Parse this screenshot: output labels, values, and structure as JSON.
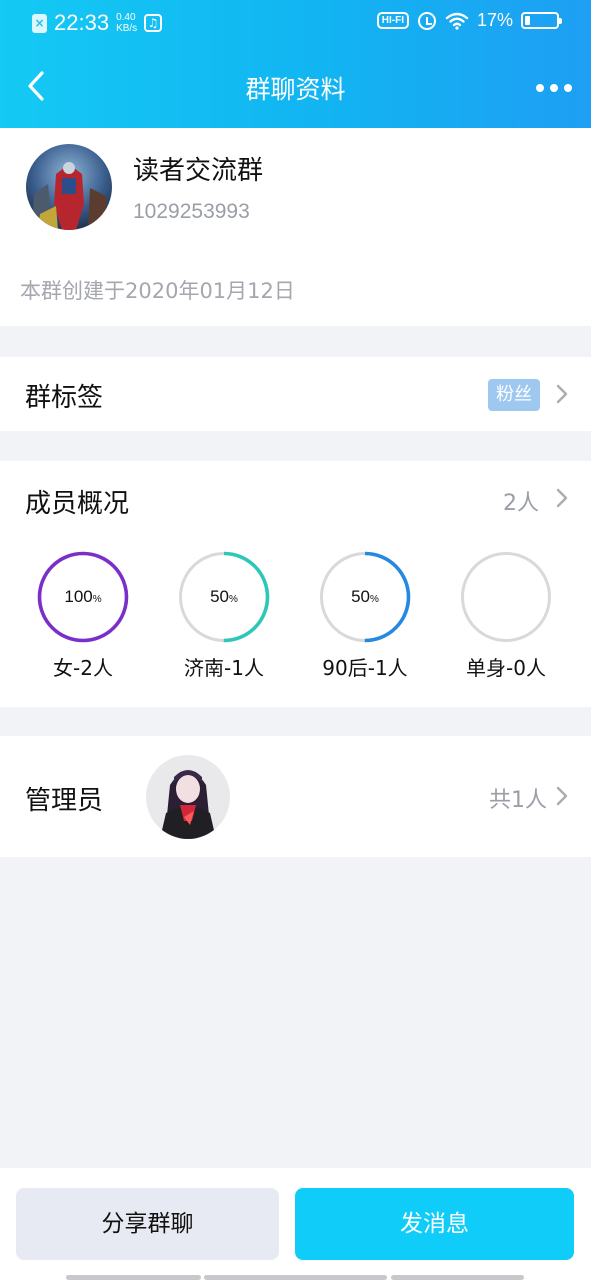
{
  "status_bar": {
    "time": "22:33",
    "speed_value": "0.40",
    "speed_unit": "KB/s",
    "hifi": "HI-FI",
    "battery": "17%",
    "battery_level": 0.17
  },
  "header": {
    "title": "群聊资料",
    "back_icon": "chevron-left-icon",
    "more_icon": "more-dots-icon"
  },
  "group": {
    "name": "读者交流群",
    "id": "1029253993",
    "created": "本群创建于2020年01月12日"
  },
  "tags": {
    "label": "群标签",
    "tag": "粉丝"
  },
  "members": {
    "label": "成员概况",
    "count": "2人",
    "stats": [
      {
        "percent_text": "100",
        "unit": "%",
        "percent": 100,
        "label": "女-2人",
        "color": "#7b2fc9"
      },
      {
        "percent_text": "50",
        "unit": "%",
        "percent": 50,
        "label": "济南-1人",
        "color": "#2ec6b6"
      },
      {
        "percent_text": "50",
        "unit": "%",
        "percent": 50,
        "label": "90后-1人",
        "color": "#2589e0"
      },
      {
        "percent_text": "",
        "unit": "",
        "percent": 0,
        "label": "单身-0人",
        "color": "#d9d9dc"
      }
    ]
  },
  "admin": {
    "label": "管理员",
    "count": "共1人"
  },
  "actions": {
    "share": "分享群聊",
    "send": "发消息"
  },
  "colors": {
    "accent": "#0fcdf8",
    "header_gradient_start": "#14c9f4",
    "header_gradient_end": "#1e9ff3",
    "tag_badge": "#9fc8f1",
    "ring_track": "#d9d9dc"
  }
}
